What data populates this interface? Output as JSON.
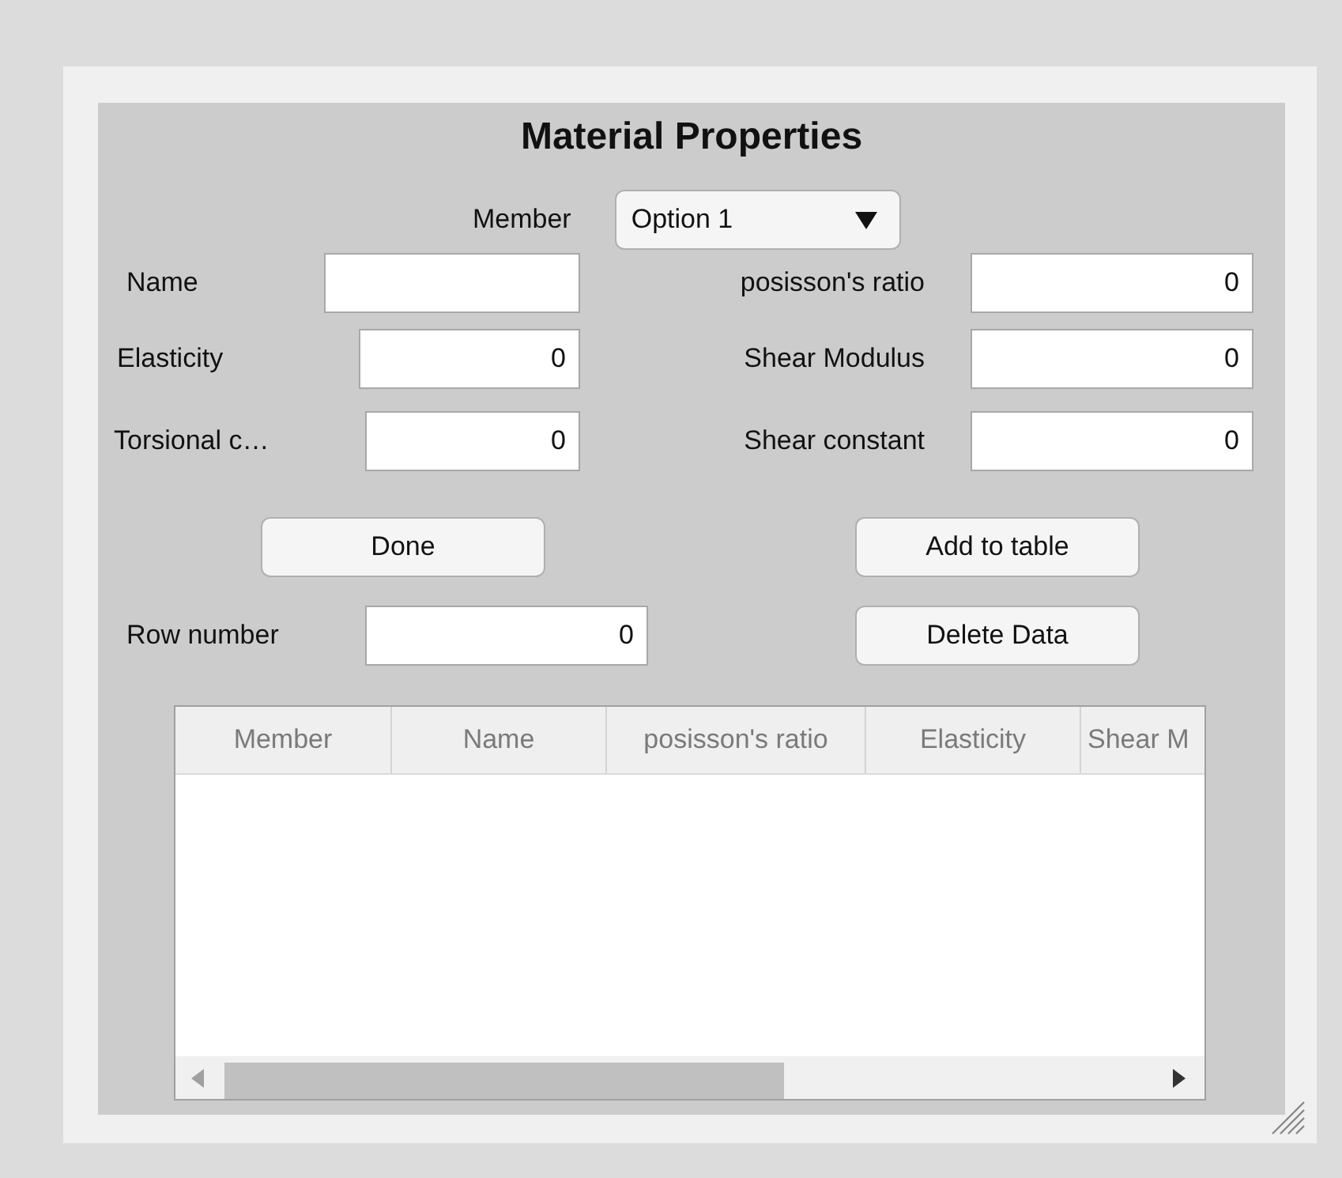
{
  "title": "Material Properties",
  "member": {
    "label": "Member",
    "value": "Option 1"
  },
  "fields": [
    {
      "label": "Name"
    },
    {
      "label": "posisson's ratio",
      "value": "0"
    },
    {
      "label": "Elasticity",
      "value": "0"
    },
    {
      "label": "Shear Modulus",
      "value": "0"
    },
    {
      "label": "Torsional c…",
      "value": "0"
    },
    {
      "label": "Shear constant",
      "value": "0"
    }
  ],
  "buttons": [
    "Done",
    "Add to table",
    "Delete Data"
  ],
  "row_number": {
    "label": "Row number",
    "value": "0"
  },
  "table": {
    "columns": [
      "Member",
      "Name",
      "posisson's ratio",
      "Elasticity",
      "Shear M"
    ]
  }
}
